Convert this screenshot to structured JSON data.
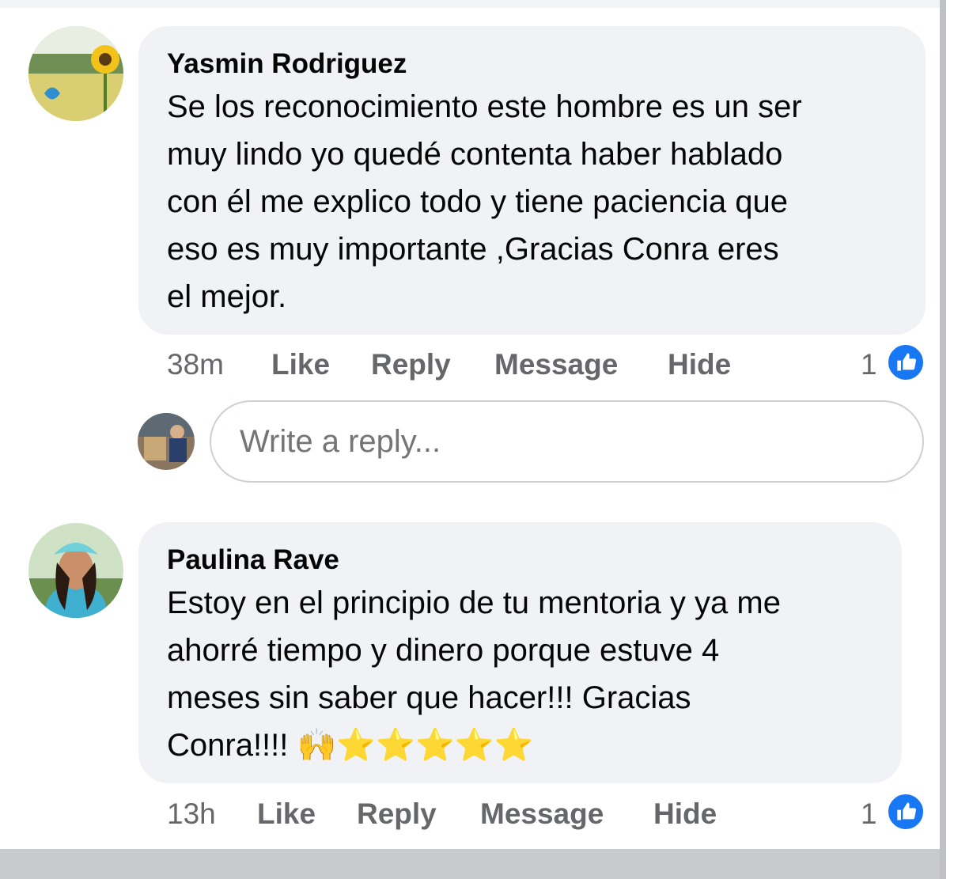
{
  "comments": [
    {
      "author": "Yasmin Rodriguez",
      "lines": [
        "Se los reconocimiento este hombre es un ser",
        "muy lindo yo quedé contenta haber hablado",
        "con él me explico todo y tiene paciencia que",
        "eso es muy importante ,Gracias Conra eres",
        "el mejor."
      ],
      "time": "38m",
      "actions": {
        "like": "Like",
        "reply": "Reply",
        "message": "Message",
        "hide": "Hide"
      },
      "reaction_count": "1"
    },
    {
      "author": "Paulina Rave",
      "lines": [
        "Estoy en el principio de tu mentoria y ya me",
        "ahorré tiempo y dinero porque estuve 4",
        "meses sin saber que hacer!!! Gracias"
      ],
      "last_line": "Conra!!!!",
      "emojis": "🙌⭐⭐⭐⭐⭐",
      "time": "13h",
      "actions": {
        "like": "Like",
        "reply": "Reply",
        "message": "Message",
        "hide": "Hide"
      },
      "reaction_count": "1"
    }
  ],
  "reply_box": {
    "placeholder": "Write a reply..."
  },
  "colors": {
    "like_blue": "#1877f2",
    "bubble": "#f0f2f5",
    "secondary_text": "#65676b"
  },
  "icons": {
    "reaction": "thumbs-up-icon"
  }
}
